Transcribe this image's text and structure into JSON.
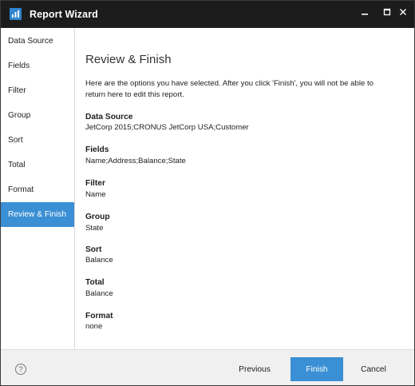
{
  "window": {
    "title": "Report Wizard",
    "controls": {
      "minimize": "_",
      "maximize": "□",
      "close": "✕"
    }
  },
  "sidebar": {
    "items": [
      {
        "label": "Data Source",
        "active": false
      },
      {
        "label": "Fields",
        "active": false
      },
      {
        "label": "Filter",
        "active": false
      },
      {
        "label": "Group",
        "active": false
      },
      {
        "label": "Sort",
        "active": false
      },
      {
        "label": "Total",
        "active": false
      },
      {
        "label": "Format",
        "active": false
      },
      {
        "label": "Review & Finish",
        "active": true
      }
    ]
  },
  "main": {
    "title": "Review & Finish",
    "intro": "Here are the options you have selected. After you click 'Finish', you will not be able to return here to edit this report.",
    "sections": [
      {
        "label": "Data Source",
        "value": "JetCorp 2015;CRONUS JetCorp USA;Customer"
      },
      {
        "label": "Fields",
        "value": "Name;Address;Balance;State"
      },
      {
        "label": "Filter",
        "value": "Name"
      },
      {
        "label": "Group",
        "value": "State"
      },
      {
        "label": "Sort",
        "value": "Balance"
      },
      {
        "label": "Total",
        "value": "Balance"
      },
      {
        "label": "Format",
        "value": "none"
      }
    ]
  },
  "footer": {
    "help_glyph": "?",
    "previous_label": "Previous",
    "finish_label": "Finish",
    "cancel_label": "Cancel"
  },
  "colors": {
    "titlebar": "#1c1c1c",
    "accent": "#3b8fd4",
    "footer_bg": "#f0f0f0"
  }
}
